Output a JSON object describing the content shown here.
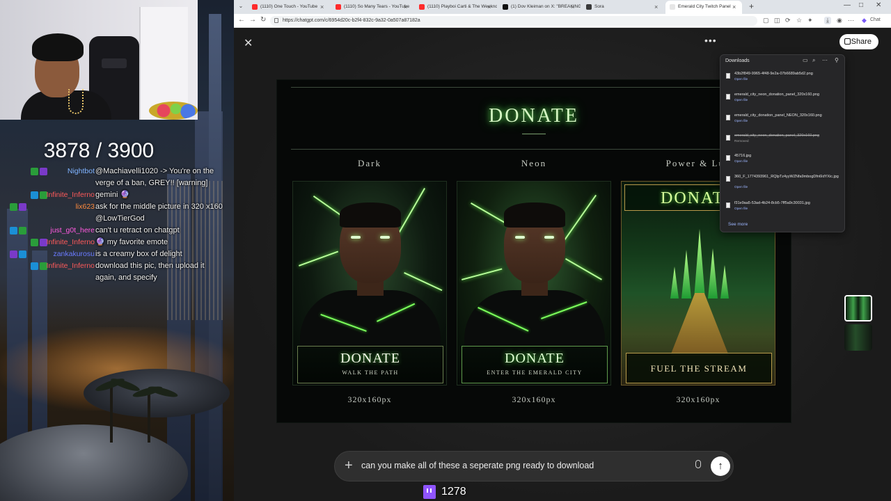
{
  "stream": {
    "sub_counter": "3878 / 3900",
    "viewer_count": "1278",
    "chat": [
      {
        "user": "Nightbot",
        "text": "@Machiavelli1020 -> You're on the",
        "user_color": "#7fb3ff"
      },
      {
        "user": "",
        "text": "verge of a ban, GREY!! [warning]",
        "user_color": "#ffffff"
      },
      {
        "user": "Infinite_Inferno",
        "text": "gemini 🔮",
        "user_color": "#ff5a5a"
      },
      {
        "user": "lix623",
        "text": "ask for the middle picture in 320 x160",
        "user_color": "#ff8a3c"
      },
      {
        "user": "",
        "text": "@LowTierGod",
        "user_color": "#ffffff"
      },
      {
        "user": "just_g0t_here",
        "text": "can't u retract on chatgpt",
        "user_color": "#ff5ae0"
      },
      {
        "user": "Infinite_Inferno",
        "text": "🔮 my favorite emote",
        "user_color": "#ff5a5a"
      },
      {
        "user": "zankakurosu",
        "text": "is a creamy box of delight",
        "user_color": "#6a7bff"
      },
      {
        "user": "Infinite_Inferno",
        "text": "download this pic, then upload it",
        "user_color": "#ff5a5a"
      },
      {
        "user": "",
        "text": "again, and specify",
        "user_color": "#ffffff"
      }
    ]
  },
  "browser": {
    "tabs": [
      {
        "title": "(1110) One Touch - YouTube",
        "favicon_color": "#ff2b2b"
      },
      {
        "title": "(1110) So Many Tears - YouTube",
        "favicon_color": "#ff2b2b"
      },
      {
        "title": "(1110) Playboi Carti & The Weeknd",
        "favicon_color": "#ff2b2b"
      },
      {
        "title": "(1) Dov Kleiman on X: \"BREAKING",
        "favicon_color": "#111111"
      },
      {
        "title": "Sora",
        "favicon_color": "#3a3a3a"
      },
      {
        "title": "Emerald City Twitch Panel",
        "favicon_color": "#e6e6e6"
      }
    ],
    "url": "https://chatgpt.com/c/6954d20c-b2f4-832c-9a32-0a507a87182a",
    "chat_label": "Chat"
  },
  "chatgpt": {
    "share_label": "Share",
    "prompt_text": "can you make all of these a seperate png ready to download"
  },
  "artwork": {
    "title": "DONATE",
    "columns": [
      {
        "label": "Dark",
        "plate_title": "DONATE",
        "plate_sub": "WALK THE PATH",
        "size": "320x160px"
      },
      {
        "label": "Neon",
        "plate_title": "DONATE",
        "plate_sub": "ENTER THE EMERALD CITY",
        "size": "320x160px"
      },
      {
        "label": "Power & Lux",
        "plate_title": "DONATE",
        "plate_sub": "FUEL THE STREAM",
        "size": "320x160px"
      }
    ]
  },
  "downloads": {
    "title": "Downloads",
    "see_more": "See more",
    "items": [
      {
        "name": "43b2f849-9965-4f48-9e2a-07b6689ab5d2.png",
        "status": "Open file",
        "removed": false
      },
      {
        "name": "emerald_city_neon_donation_panel_320x160.png",
        "status": "Open file",
        "removed": false
      },
      {
        "name": "emerald_city_donation_panel_NEON_320x160.png",
        "status": "Open file",
        "removed": false
      },
      {
        "name": "emerald_city_neon_donation_panel_320x160.png",
        "status": "Removed",
        "removed": true
      },
      {
        "name": "45716.jpg",
        "status": "Open file",
        "removed": false
      },
      {
        "name": "360_F_1774393961_RQlpTz4yyWZNfa9mbogDfn6IdYXic.jpg",
        "status": "Open file",
        "removed": false
      },
      {
        "name": "f31e9aa5-53ad-4b24-8cb5-7ff5a9c30031.jpg",
        "status": "Open file",
        "removed": false
      }
    ]
  }
}
